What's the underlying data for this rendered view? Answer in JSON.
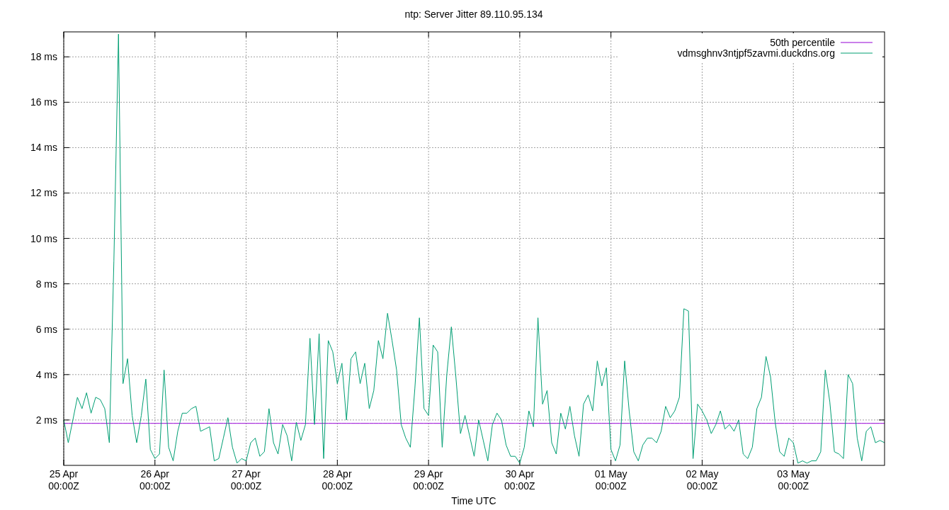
{
  "chart_data": {
    "type": "line",
    "title": "ntp: Server Jitter 89.110.95.134",
    "xlabel": "Time UTC",
    "categories": [
      "25 Apr\n00:00Z",
      null,
      null,
      null,
      null,
      null,
      null,
      null,
      null,
      null,
      null,
      null,
      null,
      null,
      null,
      null,
      null,
      null,
      null,
      null,
      "26 Apr\n00:00Z",
      null,
      null,
      null,
      null,
      null,
      null,
      null,
      null,
      null,
      null,
      null,
      null,
      null,
      null,
      null,
      null,
      null,
      null,
      null,
      "27 Apr\n00:00Z",
      null,
      null,
      null,
      null,
      null,
      null,
      null,
      null,
      null,
      null,
      null,
      null,
      null,
      null,
      null,
      null,
      null,
      null,
      null,
      "28 Apr\n00:00Z",
      null,
      null,
      null,
      null,
      null,
      null,
      null,
      null,
      null,
      null,
      null,
      null,
      null,
      null,
      null,
      null,
      null,
      null,
      null,
      "29 Apr\n00:00Z",
      null,
      null,
      null,
      null,
      null,
      null,
      null,
      null,
      null,
      null,
      null,
      null,
      null,
      null,
      null,
      null,
      null,
      null,
      null,
      "30 Apr\n00:00Z",
      null,
      null,
      null,
      null,
      null,
      null,
      null,
      null,
      null,
      null,
      null,
      null,
      null,
      null,
      null,
      null,
      null,
      null,
      null,
      "01 May\n00:00Z",
      null,
      null,
      null,
      null,
      null,
      null,
      null,
      null,
      null,
      null,
      null,
      null,
      null,
      null,
      null,
      null,
      null,
      null,
      null,
      "02 May\n00:00Z",
      null,
      null,
      null,
      null,
      null,
      null,
      null,
      null,
      null,
      null,
      null,
      null,
      null,
      null,
      null,
      null,
      null,
      null,
      null,
      "03 May\n00:00Z",
      null,
      null,
      null,
      null,
      null,
      null,
      null,
      null,
      null,
      null,
      null,
      null,
      null,
      null,
      null,
      null,
      null,
      null,
      null,
      null
    ],
    "series": [
      {
        "name": "50th percentile",
        "color": "#9400d3",
        "values": [
          1.85,
          1.85,
          1.85,
          1.85,
          1.85,
          1.85,
          1.85,
          1.85,
          1.85,
          1.85,
          1.85,
          1.85,
          1.85,
          1.85,
          1.85,
          1.85,
          1.85,
          1.85,
          1.85,
          1.85,
          1.85,
          1.85,
          1.85,
          1.85,
          1.85,
          1.85,
          1.85,
          1.85,
          1.85,
          1.85,
          1.85,
          1.85,
          1.85,
          1.85,
          1.85,
          1.85,
          1.85,
          1.85,
          1.85,
          1.85,
          1.85,
          1.85,
          1.85,
          1.85,
          1.85,
          1.85,
          1.85,
          1.85,
          1.85,
          1.85,
          1.85,
          1.85,
          1.85,
          1.85,
          1.85,
          1.85,
          1.85,
          1.85,
          1.85,
          1.85,
          1.85,
          1.85,
          1.85,
          1.85,
          1.85,
          1.85,
          1.85,
          1.85,
          1.85,
          1.85,
          1.85,
          1.85,
          1.85,
          1.85,
          1.85,
          1.85,
          1.85,
          1.85,
          1.85,
          1.85,
          1.85,
          1.85,
          1.85,
          1.85,
          1.85,
          1.85,
          1.85,
          1.85,
          1.85,
          1.85,
          1.85,
          1.85,
          1.85,
          1.85,
          1.85,
          1.85,
          1.85,
          1.85,
          1.85,
          1.85,
          1.85,
          1.85,
          1.85,
          1.85,
          1.85,
          1.85,
          1.85,
          1.85,
          1.85,
          1.85,
          1.85,
          1.85,
          1.85,
          1.85,
          1.85,
          1.85,
          1.85,
          1.85,
          1.85,
          1.85,
          1.85,
          1.85,
          1.85,
          1.85,
          1.85,
          1.85,
          1.85,
          1.85,
          1.85,
          1.85,
          1.85,
          1.85,
          1.85,
          1.85,
          1.85,
          1.85,
          1.85,
          1.85,
          1.85,
          1.85,
          1.85,
          1.85,
          1.85,
          1.85,
          1.85,
          1.85,
          1.85,
          1.85,
          1.85,
          1.85,
          1.85,
          1.85,
          1.85,
          1.85,
          1.85,
          1.85,
          1.85,
          1.85,
          1.85,
          1.85,
          1.85,
          1.85,
          1.85,
          1.85,
          1.85,
          1.85,
          1.85,
          1.85,
          1.85,
          1.85,
          1.85,
          1.85,
          1.85,
          1.85,
          1.85,
          1.85,
          1.85,
          1.85,
          1.85,
          1.85,
          1.85
        ]
      },
      {
        "name": "vdmsghnv3ntjpf5zavmi.duckdns.org",
        "color": "#009e73",
        "values": [
          2.0,
          1.0,
          2.0,
          3.0,
          2.5,
          3.2,
          2.3,
          3.0,
          2.9,
          2.5,
          1.0,
          9.0,
          19.0,
          3.6,
          4.7,
          2.2,
          1.0,
          2.2,
          3.8,
          0.7,
          0.3,
          0.5,
          4.2,
          0.8,
          0.2,
          1.5,
          2.3,
          2.3,
          2.5,
          2.6,
          1.5,
          1.6,
          1.7,
          0.2,
          0.3,
          1.2,
          2.1,
          0.8,
          0.1,
          0.3,
          0.2,
          1.0,
          1.2,
          0.4,
          0.6,
          2.5,
          1.0,
          0.5,
          1.8,
          1.3,
          0.2,
          1.9,
          1.1,
          1.8,
          5.6,
          1.8,
          5.8,
          0.3,
          5.5,
          5.0,
          3.6,
          4.5,
          2.0,
          4.7,
          5.0,
          3.6,
          4.5,
          2.5,
          3.3,
          5.5,
          4.7,
          6.7,
          5.5,
          4.2,
          1.8,
          1.2,
          0.8,
          3.4,
          6.5,
          2.5,
          2.2,
          5.3,
          5.0,
          0.8,
          4.0,
          6.1,
          3.9,
          1.4,
          2.2,
          1.3,
          0.4,
          2.0,
          1.1,
          0.2,
          1.8,
          2.3,
          2.0,
          0.9,
          0.4,
          0.4,
          0.1,
          0.8,
          2.4,
          1.7,
          6.5,
          2.7,
          3.3,
          1.0,
          0.5,
          2.3,
          1.6,
          2.6,
          1.3,
          0.4,
          2.7,
          3.1,
          2.4,
          4.6,
          3.5,
          4.3,
          0.7,
          0.2,
          0.9,
          4.6,
          2.4,
          0.6,
          0.2,
          0.9,
          1.2,
          1.2,
          1.0,
          1.5,
          2.6,
          2.1,
          2.4,
          3.0,
          6.9,
          6.8,
          0.3,
          2.7,
          2.4,
          2.0,
          1.4,
          1.8,
          2.4,
          1.6,
          1.8,
          1.5,
          2.0,
          0.5,
          0.3,
          0.8,
          2.5,
          3.0,
          4.8,
          3.9,
          1.9,
          0.6,
          0.4,
          1.2,
          1.0,
          0.1,
          0.2,
          0.1,
          0.2,
          0.2,
          0.6,
          4.2,
          2.8,
          0.6,
          0.5,
          0.3,
          4.0,
          3.6,
          1.2,
          0.2,
          1.5,
          1.7,
          1.0,
          1.1,
          1.0
        ]
      }
    ],
    "ylim": [
      0,
      19.1
    ],
    "grid": true,
    "legend": "top right",
    "yticks": [
      {
        "value": 2,
        "label": "2 ms"
      },
      {
        "value": 4,
        "label": "4 ms"
      },
      {
        "value": 6,
        "label": "6 ms"
      },
      {
        "value": 8,
        "label": "8 ms"
      },
      {
        "value": 10,
        "label": "10 ms"
      },
      {
        "value": 12,
        "label": "12 ms"
      },
      {
        "value": 14,
        "label": "14 ms"
      },
      {
        "value": 16,
        "label": "16 ms"
      },
      {
        "value": 18,
        "label": "18 ms"
      }
    ]
  }
}
